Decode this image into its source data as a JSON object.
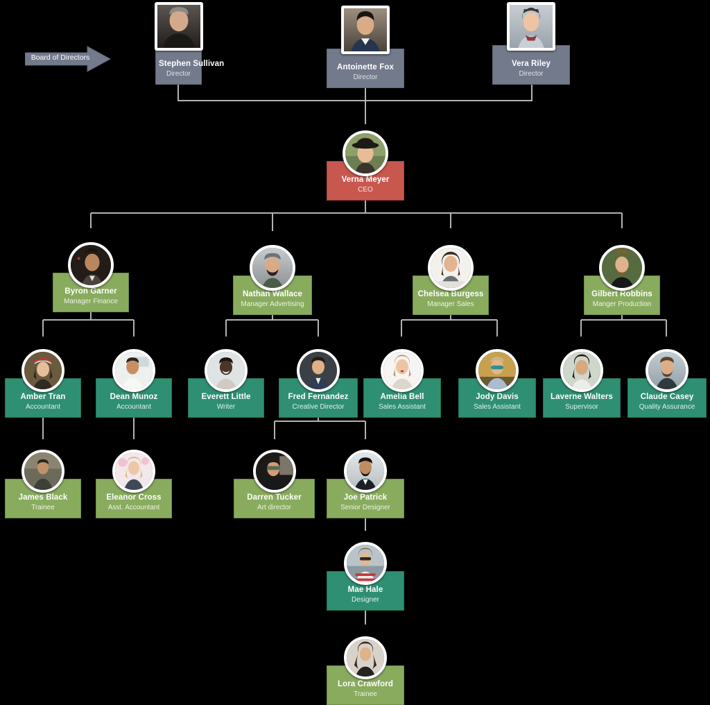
{
  "chart": {
    "kind": "organization-chart",
    "background": "#000000",
    "edge_color": "#b3b3b3",
    "annotation": {
      "label": "Board of Directors",
      "shape": "right-arrow",
      "fill": "#737a8c"
    },
    "levels": [
      {
        "key": "director",
        "card_fill": "#737a8c",
        "avatar_shape": "square"
      },
      {
        "key": "ceo",
        "card_fill": "#c8584e",
        "avatar_shape": "circle"
      },
      {
        "key": "manager",
        "card_fill": "#89ab5e",
        "avatar_shape": "circle"
      },
      {
        "key": "staff",
        "card_fill": "#2f8f73",
        "avatar_shape": "circle"
      },
      {
        "key": "junior",
        "card_fill": "#89ab5e",
        "avatar_shape": "circle"
      }
    ]
  },
  "nodes": [
    {
      "id": "stephen",
      "name": "Stephen Sullivan",
      "title": "Director",
      "level": "director",
      "avatar": "portrait-stephen-sullivan"
    },
    {
      "id": "antoinette",
      "name": "Antoinette Fox",
      "title": "Director",
      "level": "director",
      "avatar": "portrait-antoinette-fox"
    },
    {
      "id": "vera",
      "name": "Vera Riley",
      "title": "Director",
      "level": "director",
      "avatar": "portrait-vera-riley"
    },
    {
      "id": "verna",
      "name": "Verna Meyer",
      "title": "CEO",
      "level": "ceo",
      "avatar": "portrait-verna-meyer"
    },
    {
      "id": "byron",
      "name": "Byron Garner",
      "title": "Manager Finance",
      "level": "manager",
      "avatar": "portrait-byron-garner"
    },
    {
      "id": "nathan",
      "name": "Nathan Wallace",
      "title": "Manager Advertising",
      "level": "manager",
      "avatar": "portrait-nathan-wallace"
    },
    {
      "id": "chelsea",
      "name": "Chelsea Burgess",
      "title": "Manager Sales",
      "level": "manager",
      "avatar": "portrait-chelsea-burgess"
    },
    {
      "id": "gilbert",
      "name": "Gilbert Robbins",
      "title": "Manger Production",
      "level": "manager",
      "avatar": "portrait-gilbert-robbins"
    },
    {
      "id": "amber",
      "name": "Amber Tran",
      "title": "Accountant",
      "level": "staff",
      "avatar": "portrait-amber-tran"
    },
    {
      "id": "dean",
      "name": "Dean Munoz",
      "title": "Accountant",
      "level": "staff",
      "avatar": "portrait-dean-munoz"
    },
    {
      "id": "everett",
      "name": "Everett Little",
      "title": "Writer",
      "level": "staff",
      "avatar": "portrait-everett-little"
    },
    {
      "id": "fred",
      "name": "Fred Fernandez",
      "title": "Creative Director",
      "level": "staff",
      "avatar": "portrait-fred-fernandez"
    },
    {
      "id": "amelia",
      "name": "Amelia Bell",
      "title": "Sales Assistant",
      "level": "staff",
      "avatar": "portrait-amelia-bell"
    },
    {
      "id": "jody",
      "name": "Jody Davis",
      "title": "Sales Assistant",
      "level": "staff",
      "avatar": "portrait-jody-davis"
    },
    {
      "id": "laverne",
      "name": "Laverne Walters",
      "title": "Supervisor",
      "level": "staff",
      "avatar": "portrait-laverne-walters"
    },
    {
      "id": "claude",
      "name": "Claude Casey",
      "title": "Quality Assurance",
      "level": "staff",
      "avatar": "portrait-claude-casey"
    },
    {
      "id": "james",
      "name": "James Black",
      "title": "Trainee",
      "level": "junior",
      "avatar": "portrait-james-black"
    },
    {
      "id": "eleanor",
      "name": "Eleanor Cross",
      "title": "Asst. Accountant",
      "level": "junior",
      "avatar": "portrait-eleanor-cross"
    },
    {
      "id": "darren",
      "name": "Darren Tucker",
      "title": "Art director",
      "level": "junior",
      "avatar": "portrait-darren-tucker"
    },
    {
      "id": "joe",
      "name": "Joe Patrick",
      "title": "Senior Designer",
      "level": "junior",
      "avatar": "portrait-joe-patrick"
    },
    {
      "id": "mae",
      "name": "Mae Hale",
      "title": "Designer",
      "level": "staff",
      "avatar": "portrait-mae-hale"
    },
    {
      "id": "lora",
      "name": "Lora Crawford",
      "title": "Trainee",
      "level": "junior",
      "avatar": "portrait-lora-crawford"
    }
  ],
  "reporting_lines": [
    {
      "from": "stephen",
      "to": "verna"
    },
    {
      "from": "antoinette",
      "to": "verna"
    },
    {
      "from": "vera",
      "to": "verna"
    },
    {
      "from": "verna",
      "to": "byron"
    },
    {
      "from": "verna",
      "to": "nathan"
    },
    {
      "from": "verna",
      "to": "chelsea"
    },
    {
      "from": "verna",
      "to": "gilbert"
    },
    {
      "from": "byron",
      "to": "amber"
    },
    {
      "from": "byron",
      "to": "dean"
    },
    {
      "from": "nathan",
      "to": "everett"
    },
    {
      "from": "nathan",
      "to": "fred"
    },
    {
      "from": "chelsea",
      "to": "amelia"
    },
    {
      "from": "chelsea",
      "to": "jody"
    },
    {
      "from": "gilbert",
      "to": "laverne"
    },
    {
      "from": "gilbert",
      "to": "claude"
    },
    {
      "from": "amber",
      "to": "james"
    },
    {
      "from": "dean",
      "to": "eleanor"
    },
    {
      "from": "fred",
      "to": "darren"
    },
    {
      "from": "fred",
      "to": "joe"
    },
    {
      "from": "joe",
      "to": "mae"
    },
    {
      "from": "mae",
      "to": "lora"
    }
  ]
}
